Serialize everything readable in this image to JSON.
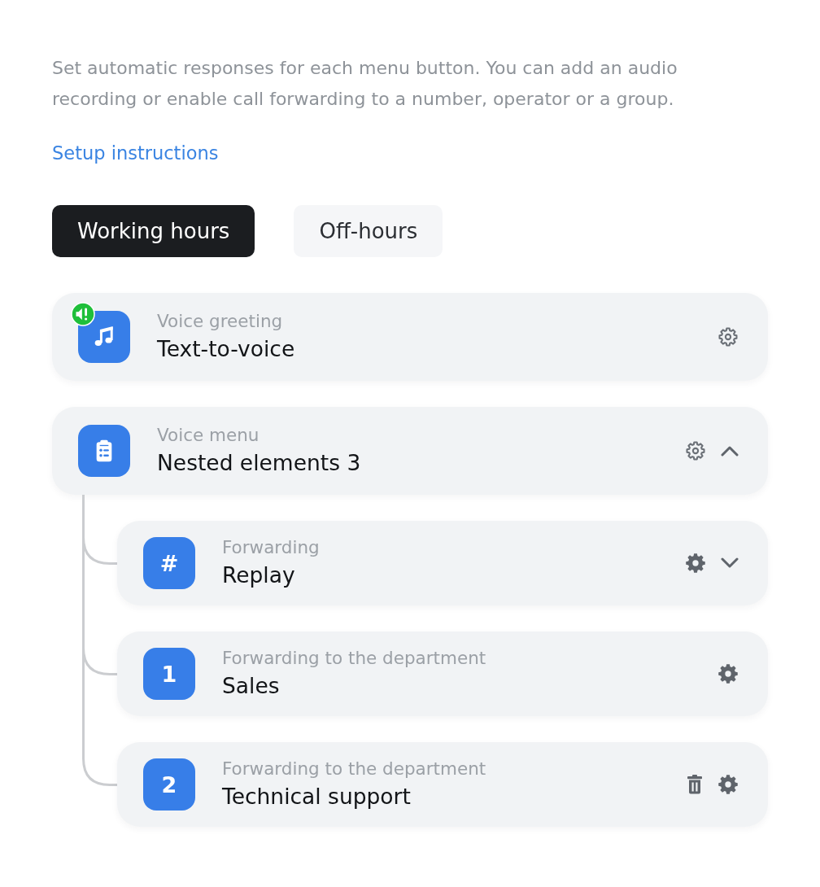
{
  "intro": {
    "description": "Set automatic responses for each menu button. You can add an audio recording or enable call forwarding to a number, operator or a group.",
    "link": "Setup instructions"
  },
  "tabs": [
    {
      "label": "Working hours",
      "selected": true
    },
    {
      "label": "Off-hours",
      "selected": false
    }
  ],
  "items": [
    {
      "icon": {
        "kind": "music"
      },
      "sound_alert": true,
      "label": "Voice greeting",
      "title": "Text-to-voice",
      "actions": [
        {
          "kind": "settings"
        }
      ]
    },
    {
      "icon": {
        "kind": "clipboard"
      },
      "sound_alert": false,
      "label": "Voice menu",
      "title": "Nested elements 3",
      "actions": [
        {
          "kind": "settings"
        }
      ],
      "expanded": true,
      "children": [
        {
          "icon": {
            "kind": "glyph",
            "text": "#"
          },
          "sound_alert": false,
          "label": "Forwarding",
          "title": "Replay",
          "actions": [
            {
              "kind": "settings"
            }
          ],
          "expanded": false
        },
        {
          "icon": {
            "kind": "glyph",
            "text": "1"
          },
          "sound_alert": false,
          "label": "Forwarding to the department",
          "title": "Sales",
          "actions": [
            {
              "kind": "settings"
            }
          ]
        },
        {
          "icon": {
            "kind": "glyph",
            "text": "2"
          },
          "sound_alert": false,
          "label": "Forwarding to the department",
          "title": "Technical support",
          "actions": [
            {
              "kind": "delete"
            },
            {
              "kind": "settings"
            }
          ]
        }
      ]
    }
  ]
}
